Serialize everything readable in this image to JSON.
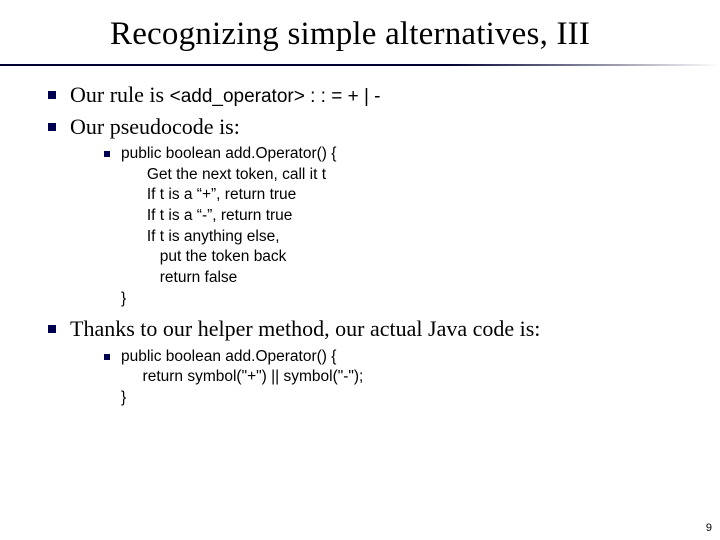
{
  "title": "Recognizing simple alternatives, III",
  "bullets": [
    {
      "prefix": "Our rule is ",
      "grammar": "<add_operator> : : = + | -"
    },
    {
      "text": "Our pseudocode is:"
    }
  ],
  "pseudo": "public boolean add.Operator() {\n      Get the next token, call it t\n      If t is a “+”, return true\n      If t is a “-”, return true\n      If t is anything else,\n         put the token back\n         return false\n}",
  "bullet3": "Thanks to our helper method, our actual Java code is:",
  "java": "public boolean add.Operator() {\n     return symbol(\"+\") || symbol(\"-\");\n}",
  "page": "9"
}
